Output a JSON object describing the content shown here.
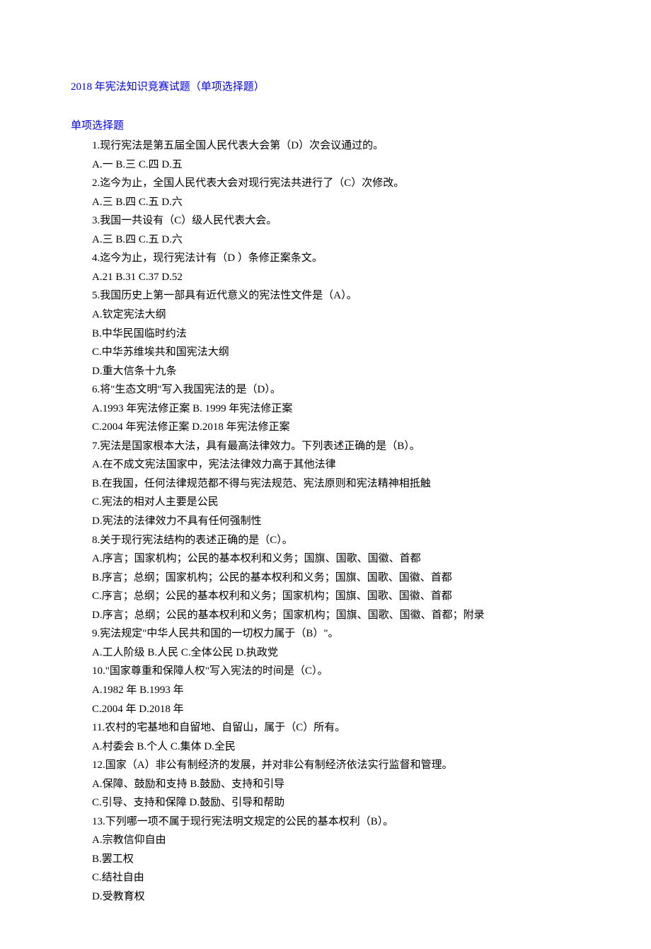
{
  "title": "2018 年宪法知识竞赛试题（单项选择题）",
  "sectionHeading": "单项选择题",
  "lines": [
    "1.现行宪法是第五届全国人民代表大会第（D）次会议通过的。",
    "A.一  B.三  C.四  D.五",
    "2.迄今为止，全国人民代表大会对现行宪法共进行了（C）次修改。",
    "A.三  B.四  C.五  D.六",
    "3.我国一共设有（C）级人民代表大会。",
    "A.三  B.四  C.五  D.六",
    "4.迄今为止，现行宪法计有（D ）条修正案条文。",
    "A.21 B.31 C.37 D.52",
    "5.我国历史上第一部具有近代意义的宪法性文件是（A）。",
    "A.钦定宪法大纲",
    "B.中华民国临时约法",
    "C.中华苏维埃共和国宪法大纲",
    "D.重大信条十九条",
    "6.将\"生态文明\"写入我国宪法的是（D）。",
    "A.1993 年宪法修正案 B. 1999 年宪法修正案",
    "C.2004 年宪法修正案 D.2018 年宪法修正案",
    "7.宪法是国家根本大法，具有最高法律效力。下列表述正确的是（B）。",
    "A.在不成文宪法国家中，宪法法律效力高于其他法律",
    "B.在我国，任何法律规范都不得与宪法规范、宪法原则和宪法精神相抵触",
    "C.宪法的相对人主要是公民",
    "D.宪法的法律效力不具有任何强制性",
    "8.关于现行宪法结构的表述正确的是（C）。",
    "A.序言；国家机构；公民的基本权利和义务；国旗、国歌、国徽、首都",
    "B.序言；总纲；国家机构；公民的基本权利和义务；国旗、国歌、国徽、首都",
    "C.序言；总纲；公民的基本权利和义务；国家机构；国旗、国歌、国徽、首都",
    "D.序言；总纲；公民的基本权利和义务；国家机构；国旗、国歌、国徽、首都；附录",
    "9.宪法规定\"中华人民共和国的一切权力属于（B）\"。",
    "A.工人阶级 B.人民 C.全体公民 D.执政党",
    "10.\"国家尊重和保障人权\"写入宪法的时间是（C）。",
    "A.1982 年  B.1993 年",
    "C.2004 年  D.2018 年",
    "11.农村的宅基地和自留地、自留山，属于（C）所有。",
    "A.村委会  B.个人  C.集体  D.全民",
    "12.国家（A）非公有制经济的发展，并对非公有制经济依法实行监督和管理。",
    "A.保障、鼓励和支持  B.鼓励、支持和引导",
    "C.引导、支持和保障  D.鼓励、引导和帮助",
    "13.下列哪一项不属于现行宪法明文规定的公民的基本权利（B）。",
    "A.宗教信仰自由",
    "B.罢工权",
    "C.结社自由",
    "D.受教育权"
  ]
}
